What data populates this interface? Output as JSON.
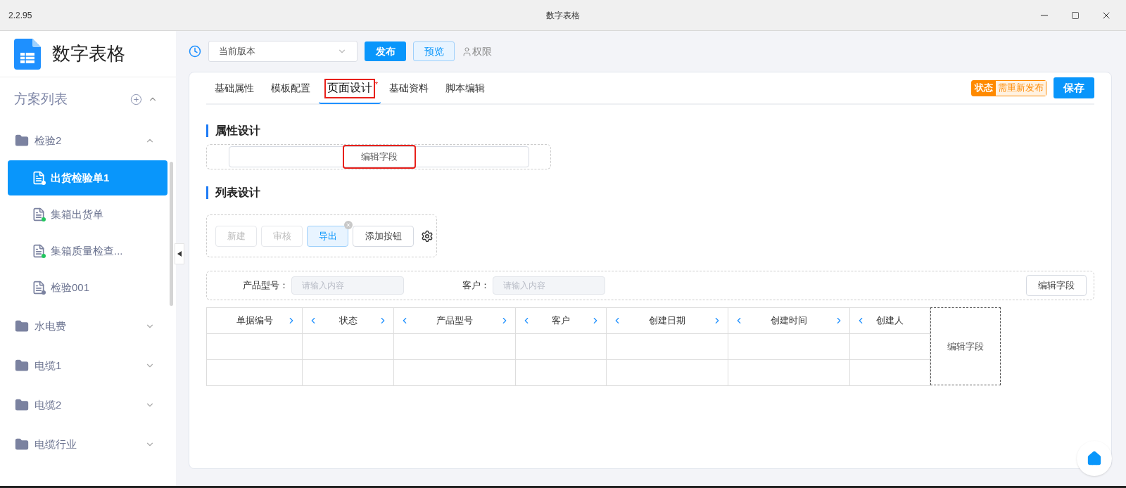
{
  "window": {
    "version": "2.2.95",
    "title": "数字表格"
  },
  "app": {
    "name": "数字表格"
  },
  "sidebar": {
    "title": "方案列表",
    "expanded": true,
    "groups": [
      {
        "label": "检验2",
        "expanded": true,
        "children": [
          {
            "label": "出货检验单1",
            "selected": true,
            "color": "#ffffff"
          },
          {
            "label": "集箱出货单",
            "selected": false,
            "color": "#22c55e"
          },
          {
            "label": "集箱质量检查...",
            "selected": false,
            "color": "#22c55e"
          },
          {
            "label": "检验001",
            "selected": false,
            "color": "#7b82a0"
          }
        ]
      },
      {
        "label": "水电费",
        "expanded": false
      },
      {
        "label": "电缆1",
        "expanded": false
      },
      {
        "label": "电缆2",
        "expanded": false
      },
      {
        "label": "电缆行业",
        "expanded": false
      }
    ]
  },
  "toolbar": {
    "version_select": "当前版本",
    "publish": "发布",
    "preview": "预览",
    "permissions": "权限"
  },
  "tabs": [
    {
      "label": "基础属性",
      "selected": false,
      "highlighted": false
    },
    {
      "label": "模板配置",
      "selected": false,
      "highlighted": false
    },
    {
      "label": "页面设计",
      "selected": true,
      "highlighted": true,
      "mark": "*"
    },
    {
      "label": "基础资料",
      "selected": false,
      "highlighted": false
    },
    {
      "label": "脚本编辑",
      "selected": false,
      "highlighted": false
    }
  ],
  "status": {
    "label": "状态",
    "value": "需重新发布"
  },
  "save": "保存",
  "attribute_design": {
    "title": "属性设计",
    "edit_fields": "编辑字段",
    "highlighted": true
  },
  "list_design": {
    "title": "列表设计",
    "buttons": [
      {
        "label": "新建",
        "kind": "disabled"
      },
      {
        "label": "审核",
        "kind": "disabled"
      },
      {
        "label": "导出",
        "kind": "active"
      },
      {
        "label": "添加按钮",
        "kind": "add"
      }
    ],
    "filters": [
      {
        "label": "产品型号：",
        "placeholder": "请输入内容"
      },
      {
        "label": "客户：",
        "placeholder": "请输入内容"
      }
    ],
    "filter_edit": "编辑字段",
    "columns": [
      {
        "label": "单据编号",
        "left": false,
        "right": true
      },
      {
        "label": "状态",
        "left": true,
        "right": true
      },
      {
        "label": "产品型号",
        "left": true,
        "right": true
      },
      {
        "label": "客户",
        "left": true,
        "right": true
      },
      {
        "label": "创建日期",
        "left": true,
        "right": true
      },
      {
        "label": "创建时间",
        "left": true,
        "right": true
      },
      {
        "label": "创建人",
        "left": true,
        "right": false
      }
    ],
    "table_edit": "编辑字段"
  }
}
